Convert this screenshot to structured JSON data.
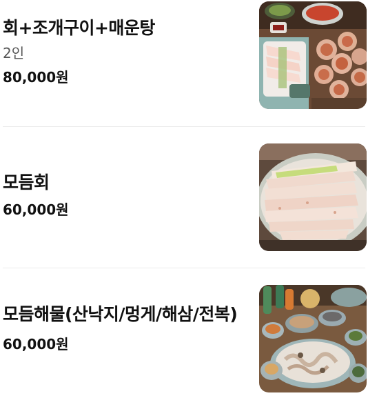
{
  "menu": {
    "items": [
      {
        "name": "회+조개구이+매운탕",
        "description": "2인",
        "price": "80,000원",
        "image": "platter-sashimi-grilled-clams-photo"
      },
      {
        "name": "모듬회",
        "description": "",
        "price": "60,000원",
        "image": "assorted-sashimi-photo"
      },
      {
        "name": "모듬해물(산낙지/멍게/해삼/전복)",
        "description": "",
        "price": "60,000원",
        "image": "assorted-seafood-photo"
      }
    ]
  },
  "colors": {
    "text": "#111111",
    "secondary_text": "#555555",
    "divider": "#ececec",
    "background": "#ffffff"
  }
}
